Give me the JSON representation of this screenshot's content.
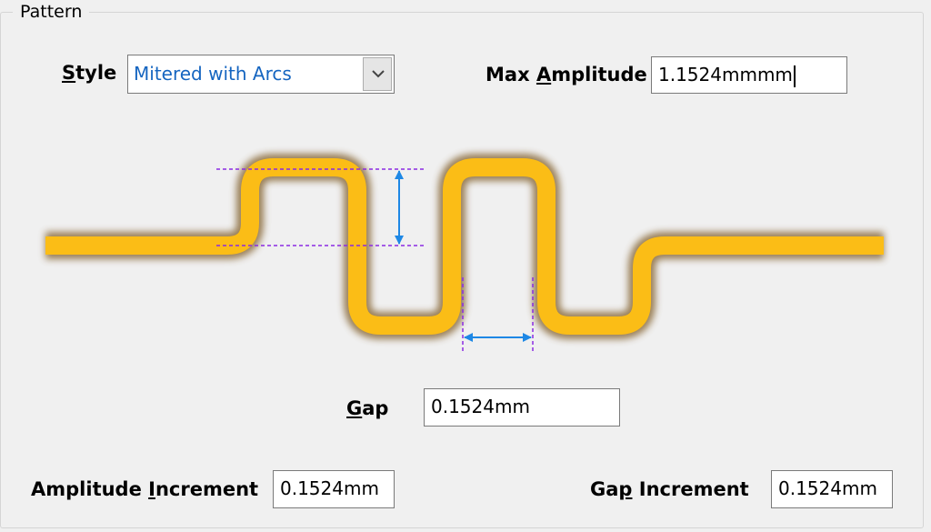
{
  "group": {
    "title": "Pattern"
  },
  "style": {
    "label_pre": "",
    "label_u": "S",
    "label_post": "tyle",
    "value": "Mitered with Arcs"
  },
  "max_amplitude": {
    "label_pre": "Max ",
    "label_u": "A",
    "label_post": "mplitude",
    "value": "1.1524mmmm"
  },
  "gap": {
    "label_u": "G",
    "label_post": "ap",
    "value": "0.1524mm"
  },
  "amplitude_increment": {
    "label_pre": "Amplitude ",
    "label_u": "I",
    "label_post": "ncrement",
    "value": "0.1524mm"
  },
  "gap_increment": {
    "label_pre": "Ga",
    "label_u": "p",
    "label_post": " Increment",
    "value": "0.1524mm"
  },
  "colors": {
    "trace": "#fbbd16",
    "trace_glow": "#8a6a3a",
    "guide": "#8a2be2",
    "arrow": "#1e88e5"
  },
  "icons": [
    "chevron-down-icon"
  ]
}
